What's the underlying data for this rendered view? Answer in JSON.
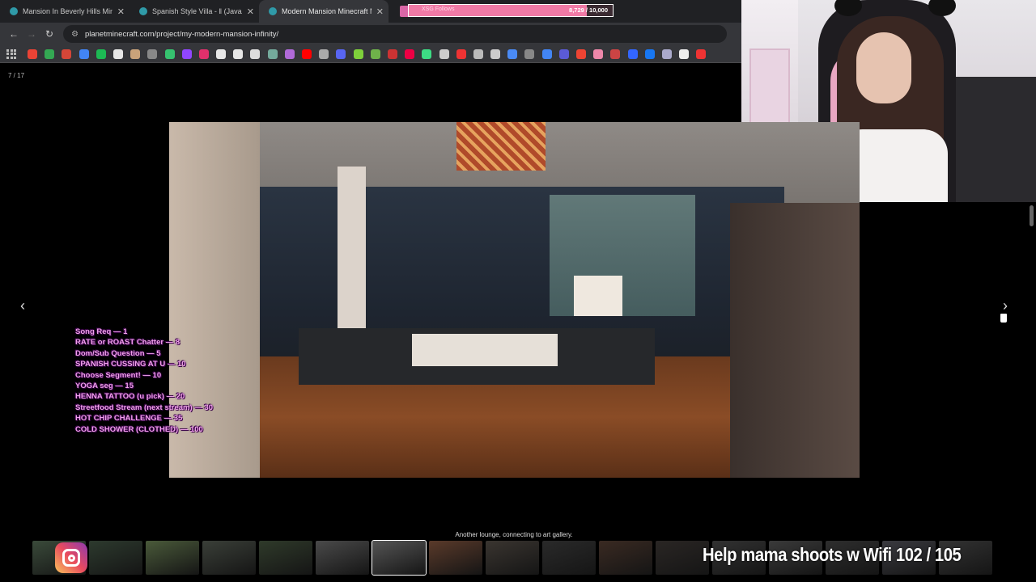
{
  "browser": {
    "tabs": [
      {
        "title": "Mansion In Beverly Hills Minec",
        "active": false
      },
      {
        "title": "Spanish Style Villa - ‖ (Java/Be",
        "active": false
      },
      {
        "title": "Modern Mansion Minecraft Ma",
        "active": true
      }
    ],
    "url": "planetminecraft.com/project/my-modern-mansion-infinity/",
    "bookmark_icons": [
      "google-icon",
      "maps-icon",
      "gmail-icon",
      "drive-icon",
      "spotify-icon",
      "x-icon",
      "cat-icon",
      "settings-icon",
      "k-icon",
      "twitch-icon",
      "instagram-icon",
      "x-icon",
      "tiktok-icon",
      "star-icon",
      "chatgpt-icon",
      "grid-icon",
      "youtube-icon",
      "box-icon",
      "discord-icon",
      "game-icon",
      "plant-icon",
      "bookmark-icon",
      "bookmark-icon",
      "play-icon",
      "circle-icon",
      "flag-icon",
      "bookmark-icon",
      "tag-icon",
      "calendar-icon",
      "print-icon",
      "browser-icon",
      "m-icon",
      "heart-icon",
      "tag-icon",
      "mail-icon",
      "page-icon",
      "facebook-icon",
      "gear-icon",
      "grid-icon",
      "pin-icon"
    ]
  },
  "follower_goal": {
    "label": "XSG Follows",
    "count_text": "8,729 / 10,000",
    "progress": 0.8729,
    "color": "#f07aa6"
  },
  "viewer": {
    "counter": "7 / 17",
    "caption": "Another lounge, connecting to art gallery.",
    "thumbnail_count": 17,
    "active_thumbnail": 7
  },
  "chat_menu": [
    "Song Req — 1",
    "RATE or ROAST Chatter — 8",
    "Dom/Sub Question — 5",
    "SPANISH CUSSING AT U — 10",
    "Choose Segment! — 10",
    "YOGA seg — 15",
    "HENNA TATTOO (u pick) — 20",
    "Streetfood Stream (next stream) — 30",
    "HOT CHIP CHALLENGE — 35",
    "COLD SHOWER (CLOTHED) — 100"
  ],
  "banner": "Help mama shoots w Wifi  102 / 105"
}
